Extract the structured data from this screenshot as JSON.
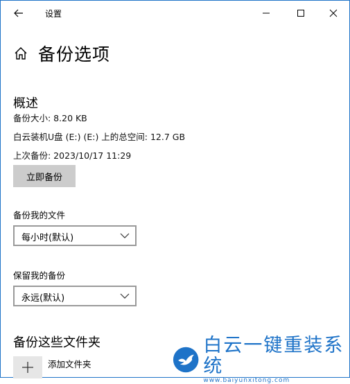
{
  "window": {
    "title": "设置"
  },
  "page": {
    "title": "备份选项"
  },
  "overview": {
    "title": "概述",
    "backup_size": "备份大小: 8.20 KB",
    "total_space": "白云装机U盘 (E:) (E:) 上的总空间: 12.7 GB",
    "last_backup": "上次备份: 2023/10/17 11:29",
    "backup_now_label": "立即备份"
  },
  "backup_files": {
    "label": "备份我的文件",
    "selected": "每小时(默认)"
  },
  "keep_backups": {
    "label": "保留我的备份",
    "selected": "永远(默认)"
  },
  "folders": {
    "title": "备份这些文件夹",
    "add_label": "添加文件夹"
  },
  "watermark": {
    "name": "白云一键重装系统",
    "url": "www.baiyunxitong.com"
  },
  "colors": {
    "accent": "#1e73c8",
    "button_bg": "#cccccc"
  }
}
